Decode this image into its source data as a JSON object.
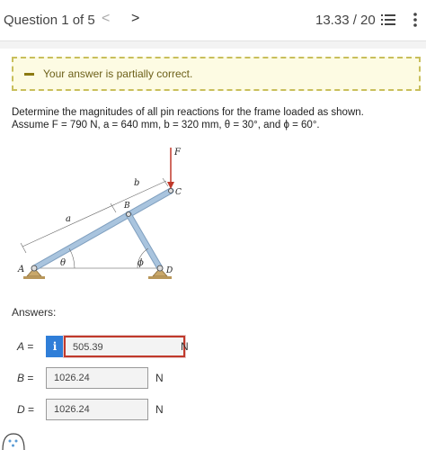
{
  "header": {
    "question_label": "Question 1 of 5",
    "prev_glyph": "<",
    "next_glyph": ">",
    "score": "13.33 / 20",
    "icons": [
      "list-icon",
      "kebab-icon"
    ]
  },
  "alert": {
    "text": "Your answer is partially correct.",
    "color": "#c9bf5c"
  },
  "problem": {
    "line1": "Determine the magnitudes of all pin reactions for the frame loaded as shown.",
    "line2": "Assume F = 790 N, a = 640 mm, b = 320 mm, θ = 30°, and ϕ = 60°."
  },
  "diagram": {
    "labels": {
      "F": "F",
      "a": "a",
      "b": "b",
      "B": "B",
      "C": "C",
      "A": "A",
      "D": "D",
      "theta": "θ",
      "phi": "ϕ"
    },
    "force_color": "#c0392b",
    "member_color": "#a9c4de"
  },
  "answers": {
    "label": "Answers:",
    "rows": [
      {
        "name": "A",
        "eq": " =",
        "value": "505.39",
        "unit": "N",
        "status": "incorrect"
      },
      {
        "name": "B",
        "eq": " =",
        "value": "1026.24",
        "unit": "N",
        "status": "correct"
      },
      {
        "name": "D",
        "eq": " =",
        "value": "1026.24",
        "unit": "N",
        "status": "correct"
      }
    ],
    "info_glyph": "i"
  }
}
